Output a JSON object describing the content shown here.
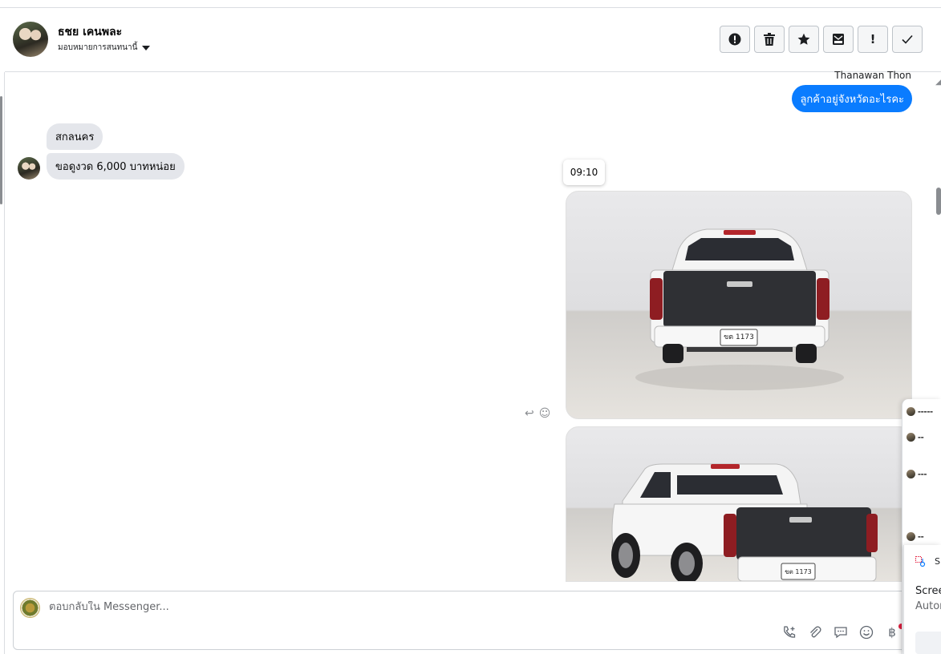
{
  "header": {
    "contact_name": "ธชย เคนพละ",
    "assign_label": "มอบหมายการสนทนานี้",
    "toolbar": [
      {
        "name": "mark-spam-button",
        "icon": "exclamation-circle-icon"
      },
      {
        "name": "delete-button",
        "icon": "trash-icon"
      },
      {
        "name": "star-button",
        "icon": "star-icon"
      },
      {
        "name": "mark-unread-button",
        "icon": "envelope-icon"
      },
      {
        "name": "follow-up-button",
        "icon": "exclamation-icon",
        "label": "!"
      },
      {
        "name": "mark-done-button",
        "icon": "check-icon"
      }
    ]
  },
  "conversation": {
    "outgoing_sender": "Thanawan Thon",
    "outgoing_text": "ลูกค้าอยู่จังหวัดอะไรคะ",
    "incoming": [
      {
        "text": "สกลนคร"
      },
      {
        "text": "ขอดูงวด 6,000 บาทหน่อย"
      }
    ],
    "timestamp": "09:10",
    "photos": [
      {
        "desc": "white pickup truck rear view",
        "plate": "ขต 1173"
      },
      {
        "desc": "white pickup truck rear three-quarter view",
        "plate": "ขต 1173"
      }
    ]
  },
  "composer": {
    "placeholder": "ตอบกลับใน Messenger...",
    "tools": [
      "call-add-icon",
      "paperclip-icon",
      "saved-reply-icon",
      "emoji-icon",
      "baht-icon"
    ]
  },
  "side_panel": {
    "snip_title": "Sn",
    "snip_line1": "Scree",
    "snip_line2": "Autom"
  },
  "colors": {
    "outgoing_bubble": "#0a7cff",
    "incoming_bubble": "#e4e6eb",
    "border": "#dadde1"
  }
}
